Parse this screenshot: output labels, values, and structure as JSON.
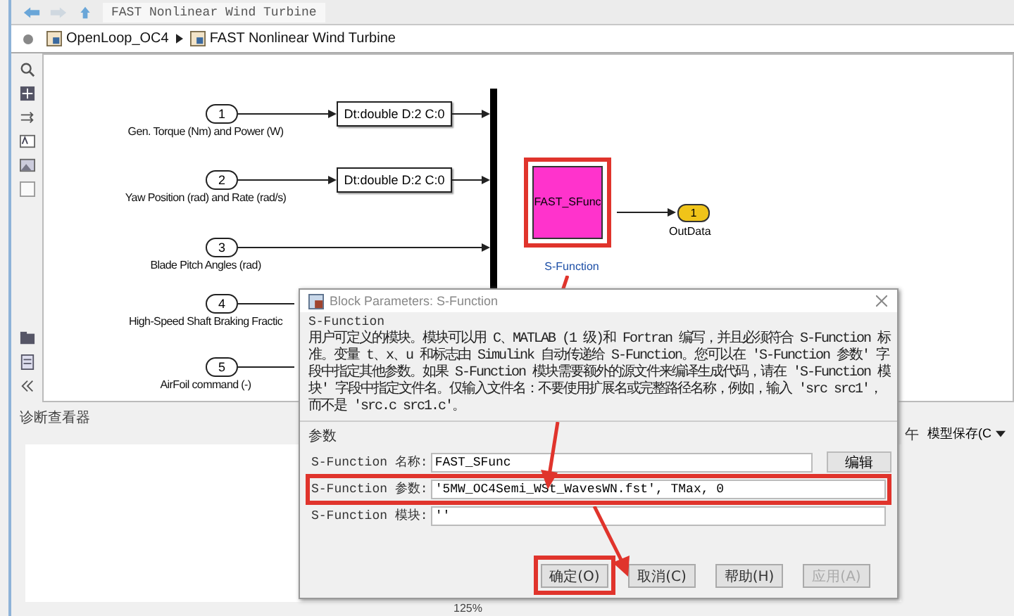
{
  "window": {
    "tab_title": "FAST Nonlinear Wind Turbine"
  },
  "breadcrumb": [
    "OpenLoop_OC4",
    "FAST Nonlinear Wind Turbine"
  ],
  "inports": [
    {
      "number": "1",
      "label": "Gen. Torque (Nm) and Power (W)",
      "converter": "Dt:double D:2 C:0"
    },
    {
      "number": "2",
      "label": "Yaw Position (rad) and Rate (rad/s)",
      "converter": "Dt:double D:2 C:0"
    },
    {
      "number": "3",
      "label": "Blade Pitch Angles (rad)"
    },
    {
      "number": "4",
      "label": "High-Speed Shaft Braking Fractic"
    },
    {
      "number": "5",
      "label": "AirFoil command (-)"
    }
  ],
  "sfunction_block": {
    "name": "FAST_SFunc",
    "caption": "S-Function",
    "highlighted": true
  },
  "outport": {
    "number": "1",
    "label": "OutData"
  },
  "diagnostics": {
    "title": "诊断查看器",
    "right_text": "午",
    "save_menu": "模型保存(C"
  },
  "status_bar": {
    "zoom": "125%"
  },
  "dialog": {
    "title": "Block Parameters: S-Function",
    "section": "S-Function",
    "description": "用户可定义的模块。模块可以用 C、MATLAB (1 级)和 Fortran 编写，并且必须符合 S-Function 标准。变量 t、x、u 和标志由 Simulink 自动传递给 S-Function。您可以在 'S-Function 参数' 字段中指定其他参数。如果 S-Function 模块需要额外的源文件来编译生成代码，请在 'S-Function 模块' 字段中指定文件名。仅输入文件名：不要使用扩展名或完整路径名称，例如，输入 'src src1'，而不是 'src.c src1.c'。",
    "params_title": "参数",
    "params": [
      {
        "label": "S-Function 名称:",
        "value": "FAST_SFunc",
        "button": "编辑",
        "highlighted": false
      },
      {
        "label": "S-Function 参数:",
        "value": "'5MW_OC4Semi_WSt_WavesWN.fst', TMax, 0",
        "highlighted": true
      },
      {
        "label": "S-Function 模块:",
        "value": "''",
        "highlighted": false
      }
    ],
    "buttons": [
      {
        "label": "确定(O)",
        "highlighted": true,
        "disabled": false
      },
      {
        "label": "取消(C)",
        "highlighted": false,
        "disabled": false
      },
      {
        "label": "帮助(H)",
        "highlighted": false,
        "disabled": false
      },
      {
        "label": "应用(A)",
        "highlighted": false,
        "disabled": true
      }
    ]
  }
}
